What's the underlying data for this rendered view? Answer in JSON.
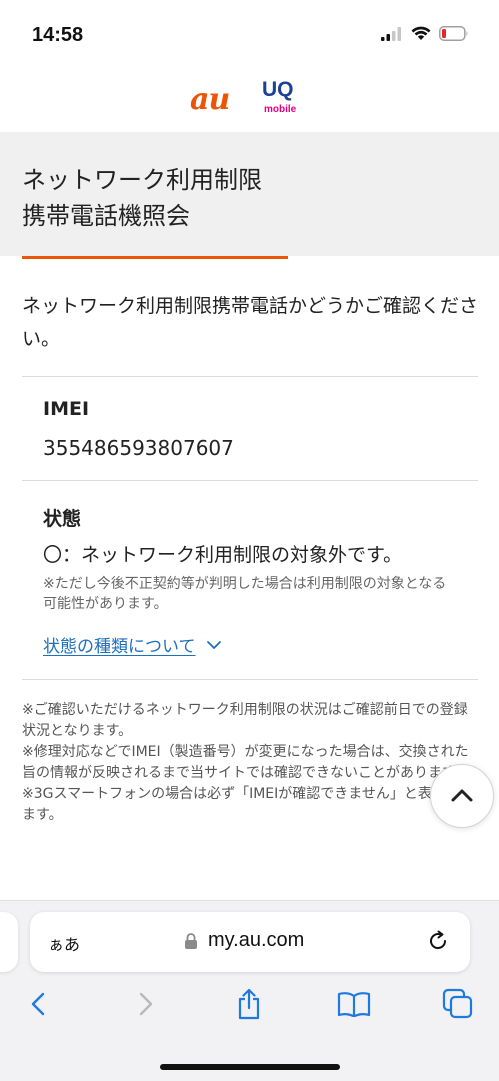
{
  "status_bar": {
    "time": "14:58"
  },
  "header": {
    "brand_au": "au",
    "brand_uq": "UQ",
    "brand_uq_sub": "mobile"
  },
  "page": {
    "title_line1": "ネットワーク利用制限",
    "title_line2": "携帯電話機照会",
    "intro": "ネットワーク利用制限携帯電話かどうかご確認ください。"
  },
  "result": {
    "imei_label": "IMEI",
    "imei_value": "355486593807607",
    "status_label": "状態",
    "status_value": "〇：ネットワーク利用制限の対象外です。",
    "status_note": "※ただし今後不正契約等が判明した場合は利用制限の対象となる可能性があります。",
    "status_types_link": "状態の種類について"
  },
  "footnotes": [
    "※ご確認いただけるネットワーク利用制限の状況はご確認前日での登録状況となります。",
    "※修理対応などでIMEI（製造番号）が変更になった場合は、交換された旨の情報が反映されるまで当サイトでは確認できないことがあります。",
    "※3Gスマートフォンの場合は必ず「IMEIが確認できません」と表記されます。"
  ],
  "browser": {
    "aa_label": "ぁあ",
    "url": "my.au.com"
  },
  "colors": {
    "accent": "#eb5505",
    "link": "#1f6fbd",
    "uq_blue": "#1d3f95",
    "uq_pink": "#e6007e",
    "ios_blue": "#1f7ae0"
  },
  "icons": {
    "status": [
      "cellular-signal-icon",
      "wifi-icon",
      "battery-low-icon"
    ],
    "toolbar": [
      "back-icon",
      "forward-icon",
      "share-icon",
      "bookmarks-icon",
      "tabs-icon"
    ]
  }
}
